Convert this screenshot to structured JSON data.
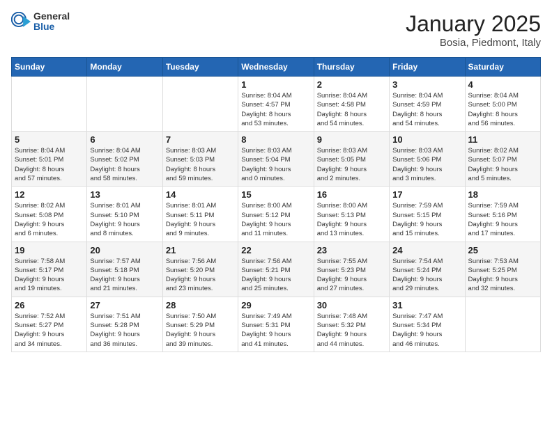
{
  "header": {
    "logo_general": "General",
    "logo_blue": "Blue",
    "month": "January 2025",
    "location": "Bosia, Piedmont, Italy"
  },
  "weekdays": [
    "Sunday",
    "Monday",
    "Tuesday",
    "Wednesday",
    "Thursday",
    "Friday",
    "Saturday"
  ],
  "weeks": [
    [
      {
        "day": "",
        "info": ""
      },
      {
        "day": "",
        "info": ""
      },
      {
        "day": "",
        "info": ""
      },
      {
        "day": "1",
        "info": "Sunrise: 8:04 AM\nSunset: 4:57 PM\nDaylight: 8 hours\nand 53 minutes."
      },
      {
        "day": "2",
        "info": "Sunrise: 8:04 AM\nSunset: 4:58 PM\nDaylight: 8 hours\nand 54 minutes."
      },
      {
        "day": "3",
        "info": "Sunrise: 8:04 AM\nSunset: 4:59 PM\nDaylight: 8 hours\nand 54 minutes."
      },
      {
        "day": "4",
        "info": "Sunrise: 8:04 AM\nSunset: 5:00 PM\nDaylight: 8 hours\nand 56 minutes."
      }
    ],
    [
      {
        "day": "5",
        "info": "Sunrise: 8:04 AM\nSunset: 5:01 PM\nDaylight: 8 hours\nand 57 minutes."
      },
      {
        "day": "6",
        "info": "Sunrise: 8:04 AM\nSunset: 5:02 PM\nDaylight: 8 hours\nand 58 minutes."
      },
      {
        "day": "7",
        "info": "Sunrise: 8:03 AM\nSunset: 5:03 PM\nDaylight: 8 hours\nand 59 minutes."
      },
      {
        "day": "8",
        "info": "Sunrise: 8:03 AM\nSunset: 5:04 PM\nDaylight: 9 hours\nand 0 minutes."
      },
      {
        "day": "9",
        "info": "Sunrise: 8:03 AM\nSunset: 5:05 PM\nDaylight: 9 hours\nand 2 minutes."
      },
      {
        "day": "10",
        "info": "Sunrise: 8:03 AM\nSunset: 5:06 PM\nDaylight: 9 hours\nand 3 minutes."
      },
      {
        "day": "11",
        "info": "Sunrise: 8:02 AM\nSunset: 5:07 PM\nDaylight: 9 hours\nand 5 minutes."
      }
    ],
    [
      {
        "day": "12",
        "info": "Sunrise: 8:02 AM\nSunset: 5:08 PM\nDaylight: 9 hours\nand 6 minutes."
      },
      {
        "day": "13",
        "info": "Sunrise: 8:01 AM\nSunset: 5:10 PM\nDaylight: 9 hours\nand 8 minutes."
      },
      {
        "day": "14",
        "info": "Sunrise: 8:01 AM\nSunset: 5:11 PM\nDaylight: 9 hours\nand 9 minutes."
      },
      {
        "day": "15",
        "info": "Sunrise: 8:00 AM\nSunset: 5:12 PM\nDaylight: 9 hours\nand 11 minutes."
      },
      {
        "day": "16",
        "info": "Sunrise: 8:00 AM\nSunset: 5:13 PM\nDaylight: 9 hours\nand 13 minutes."
      },
      {
        "day": "17",
        "info": "Sunrise: 7:59 AM\nSunset: 5:15 PM\nDaylight: 9 hours\nand 15 minutes."
      },
      {
        "day": "18",
        "info": "Sunrise: 7:59 AM\nSunset: 5:16 PM\nDaylight: 9 hours\nand 17 minutes."
      }
    ],
    [
      {
        "day": "19",
        "info": "Sunrise: 7:58 AM\nSunset: 5:17 PM\nDaylight: 9 hours\nand 19 minutes."
      },
      {
        "day": "20",
        "info": "Sunrise: 7:57 AM\nSunset: 5:18 PM\nDaylight: 9 hours\nand 21 minutes."
      },
      {
        "day": "21",
        "info": "Sunrise: 7:56 AM\nSunset: 5:20 PM\nDaylight: 9 hours\nand 23 minutes."
      },
      {
        "day": "22",
        "info": "Sunrise: 7:56 AM\nSunset: 5:21 PM\nDaylight: 9 hours\nand 25 minutes."
      },
      {
        "day": "23",
        "info": "Sunrise: 7:55 AM\nSunset: 5:23 PM\nDaylight: 9 hours\nand 27 minutes."
      },
      {
        "day": "24",
        "info": "Sunrise: 7:54 AM\nSunset: 5:24 PM\nDaylight: 9 hours\nand 29 minutes."
      },
      {
        "day": "25",
        "info": "Sunrise: 7:53 AM\nSunset: 5:25 PM\nDaylight: 9 hours\nand 32 minutes."
      }
    ],
    [
      {
        "day": "26",
        "info": "Sunrise: 7:52 AM\nSunset: 5:27 PM\nDaylight: 9 hours\nand 34 minutes."
      },
      {
        "day": "27",
        "info": "Sunrise: 7:51 AM\nSunset: 5:28 PM\nDaylight: 9 hours\nand 36 minutes."
      },
      {
        "day": "28",
        "info": "Sunrise: 7:50 AM\nSunset: 5:29 PM\nDaylight: 9 hours\nand 39 minutes."
      },
      {
        "day": "29",
        "info": "Sunrise: 7:49 AM\nSunset: 5:31 PM\nDaylight: 9 hours\nand 41 minutes."
      },
      {
        "day": "30",
        "info": "Sunrise: 7:48 AM\nSunset: 5:32 PM\nDaylight: 9 hours\nand 44 minutes."
      },
      {
        "day": "31",
        "info": "Sunrise: 7:47 AM\nSunset: 5:34 PM\nDaylight: 9 hours\nand 46 minutes."
      },
      {
        "day": "",
        "info": ""
      }
    ]
  ]
}
